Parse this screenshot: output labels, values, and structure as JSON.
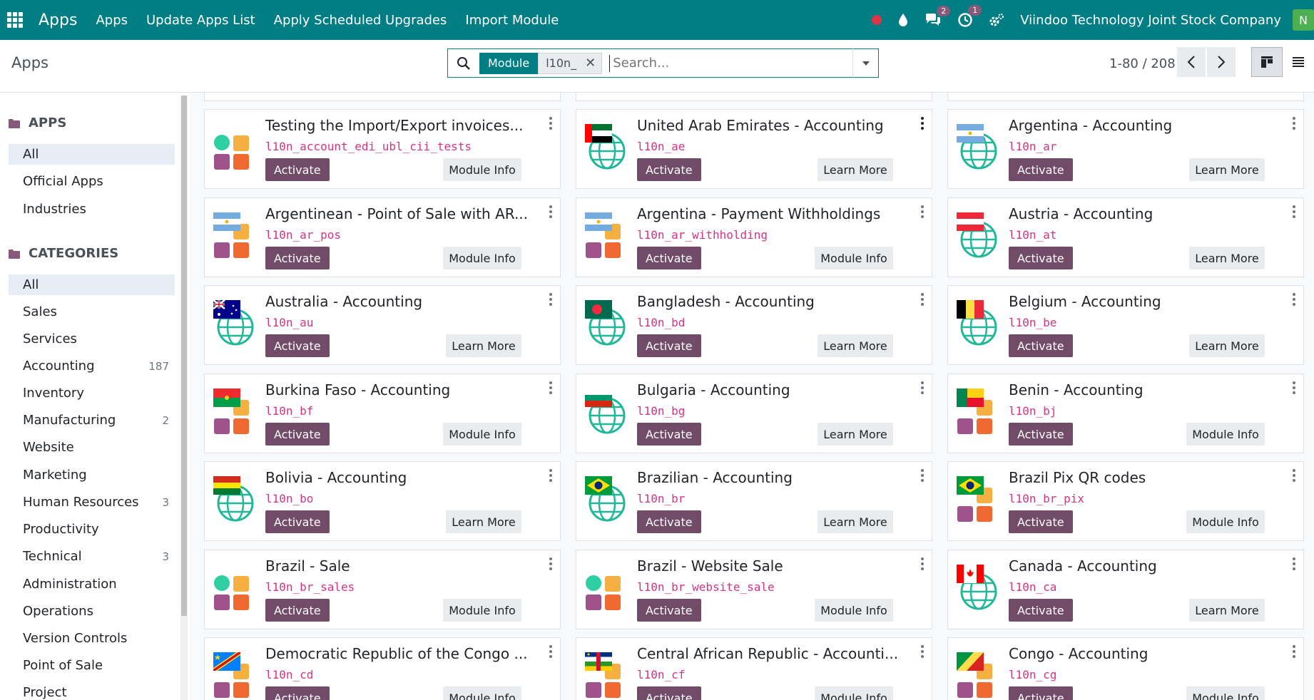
{
  "navbar": {
    "brand": "Apps",
    "menu": [
      "Apps",
      "Update Apps List",
      "Apply Scheduled Upgrades",
      "Import Module"
    ],
    "messages_badge": "2",
    "activity_badge": "1",
    "company": "Viindoo Technology Joint Stock Company",
    "avatar_letter": "N"
  },
  "control": {
    "title": "Apps",
    "facet_label": "Module",
    "facet_value": "l10n_",
    "search_placeholder": "Search...",
    "pager": "1-80 / 208"
  },
  "sidebar": {
    "apps_heading": "APPS",
    "apps_items": [
      "All",
      "Official Apps",
      "Industries"
    ],
    "categories_heading": "CATEGORIES",
    "categories": [
      {
        "label": "All",
        "count": ""
      },
      {
        "label": "Sales",
        "count": ""
      },
      {
        "label": "Services",
        "count": ""
      },
      {
        "label": "Accounting",
        "count": "187"
      },
      {
        "label": "Inventory",
        "count": ""
      },
      {
        "label": "Manufacturing",
        "count": "2"
      },
      {
        "label": "Website",
        "count": ""
      },
      {
        "label": "Marketing",
        "count": ""
      },
      {
        "label": "Human Resources",
        "count": "3"
      },
      {
        "label": "Productivity",
        "count": ""
      },
      {
        "label": "Technical",
        "count": "3"
      },
      {
        "label": "Administration",
        "count": ""
      },
      {
        "label": "Operations",
        "count": ""
      },
      {
        "label": "Version Controls",
        "count": ""
      },
      {
        "label": "Point of Sale",
        "count": ""
      },
      {
        "label": "Project",
        "count": ""
      }
    ]
  },
  "cards": [
    {
      "title": "Testing the Import/Export invoices...",
      "tech": "l10n_account_edi_ubl_cii_tests",
      "action": "Activate",
      "info": "Module Info",
      "icon": "default-module-icon"
    },
    {
      "title": "United Arab Emirates - Accounting",
      "tech": "l10n_ae",
      "action": "Activate",
      "info": "Learn More",
      "icon": "flag-globe-icon-ae"
    },
    {
      "title": "Argentina - Accounting",
      "tech": "l10n_ar",
      "action": "Activate",
      "info": "Learn More",
      "icon": "flag-globe-icon-ar"
    },
    {
      "title": "Argentinean - Point of Sale with AR...",
      "tech": "l10n_ar_pos",
      "action": "Activate",
      "info": "Module Info",
      "icon": "flag-module-icon-ar"
    },
    {
      "title": "Argentina - Payment Withholdings",
      "tech": "l10n_ar_withholding",
      "action": "Activate",
      "info": "Module Info",
      "icon": "flag-module-icon-ar"
    },
    {
      "title": "Austria - Accounting",
      "tech": "l10n_at",
      "action": "Activate",
      "info": "Learn More",
      "icon": "flag-globe-icon-at"
    },
    {
      "title": "Australia - Accounting",
      "tech": "l10n_au",
      "action": "Activate",
      "info": "Learn More",
      "icon": "flag-globe-icon-au"
    },
    {
      "title": "Bangladesh - Accounting",
      "tech": "l10n_bd",
      "action": "Activate",
      "info": "Learn More",
      "icon": "flag-globe-icon-bd"
    },
    {
      "title": "Belgium - Accounting",
      "tech": "l10n_be",
      "action": "Activate",
      "info": "Learn More",
      "icon": "flag-globe-icon-be"
    },
    {
      "title": "Burkina Faso - Accounting",
      "tech": "l10n_bf",
      "action": "Activate",
      "info": "Module Info",
      "icon": "flag-module-icon-bf"
    },
    {
      "title": "Bulgaria - Accounting",
      "tech": "l10n_bg",
      "action": "Activate",
      "info": "Learn More",
      "icon": "flag-globe-icon-bg"
    },
    {
      "title": "Benin - Accounting",
      "tech": "l10n_bj",
      "action": "Activate",
      "info": "Module Info",
      "icon": "flag-module-icon-bj"
    },
    {
      "title": "Bolivia - Accounting",
      "tech": "l10n_bo",
      "action": "Activate",
      "info": "Learn More",
      "icon": "flag-globe-icon-bo"
    },
    {
      "title": "Brazilian - Accounting",
      "tech": "l10n_br",
      "action": "Activate",
      "info": "Learn More",
      "icon": "flag-globe-icon-br"
    },
    {
      "title": "Brazil Pix QR codes",
      "tech": "l10n_br_pix",
      "action": "Activate",
      "info": "Module Info",
      "icon": "flag-module-icon-br"
    },
    {
      "title": "Brazil - Sale",
      "tech": "l10n_br_sales",
      "action": "Activate",
      "info": "Module Info",
      "icon": "default-module-icon"
    },
    {
      "title": "Brazil - Website Sale",
      "tech": "l10n_br_website_sale",
      "action": "Activate",
      "info": "Module Info",
      "icon": "default-module-icon"
    },
    {
      "title": "Canada - Accounting",
      "tech": "l10n_ca",
      "action": "Activate",
      "info": "Learn More",
      "icon": "flag-globe-icon-ca"
    },
    {
      "title": "Democratic Republic of the Congo ...",
      "tech": "l10n_cd",
      "action": "Activate",
      "info": "Module Info",
      "icon": "flag-module-icon-cd"
    },
    {
      "title": "Central African Republic - Accounti...",
      "tech": "l10n_cf",
      "action": "Activate",
      "info": "Module Info",
      "icon": "flag-module-icon-cf"
    },
    {
      "title": "Congo - Accounting",
      "tech": "l10n_cg",
      "action": "Activate",
      "info": "Module Info",
      "icon": "flag-module-icon-cg"
    }
  ]
}
